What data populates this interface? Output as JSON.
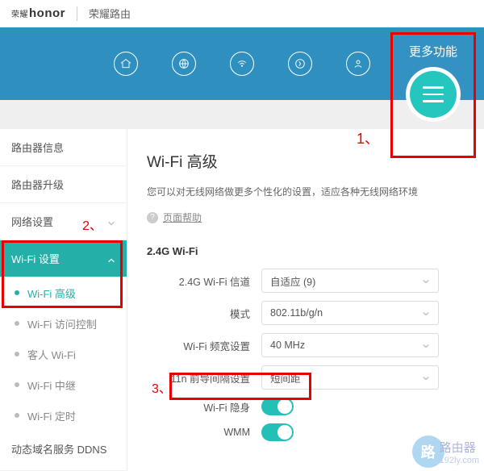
{
  "brand": {
    "cn": "荣耀",
    "en": "honor",
    "product": "荣耀路由"
  },
  "more": {
    "label": "更多功能"
  },
  "callouts": {
    "c1": "1、",
    "c2": "2、",
    "c3": "3、"
  },
  "sidebar": {
    "items": [
      {
        "label": "路由器信息"
      },
      {
        "label": "路由器升级"
      },
      {
        "label": "网络设置"
      },
      {
        "label": "Wi-Fi 设置"
      },
      {
        "label": "动态域名服务 DDNS"
      }
    ],
    "wifi_subs": [
      {
        "label": "Wi-Fi 高级"
      },
      {
        "label": "Wi-Fi 访问控制"
      },
      {
        "label": "客人 Wi-Fi"
      },
      {
        "label": "Wi-Fi 中继"
      },
      {
        "label": "Wi-Fi 定时"
      }
    ]
  },
  "page": {
    "title": "Wi-Fi 高级",
    "desc": "您可以对无线网络做更多个性化的设置，适应各种无线网络环境",
    "help": "页面帮助"
  },
  "section": {
    "title": "2.4G Wi-Fi"
  },
  "form": {
    "channel": {
      "label": "2.4G Wi-Fi 信道",
      "value": "自适应 (9)"
    },
    "mode": {
      "label": "模式",
      "value": "802.11b/g/n"
    },
    "bw": {
      "label": "Wi-Fi 频宽设置",
      "value": "40 MHz"
    },
    "preamble": {
      "label": "11n 前导间隔设置",
      "value": "短间距"
    },
    "hide": {
      "label": "Wi-Fi 隐身",
      "on": true
    },
    "wmm": {
      "label": "WMM",
      "on": true
    }
  },
  "watermark": {
    "big": "路由器",
    "small": "192ly.com"
  }
}
